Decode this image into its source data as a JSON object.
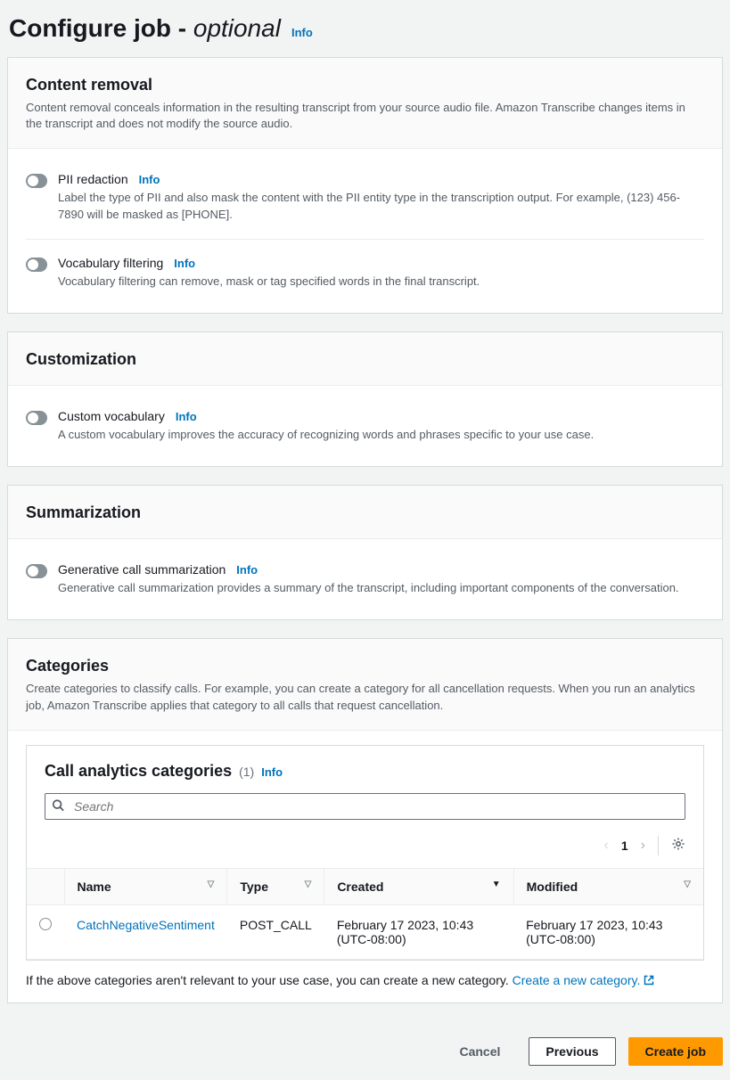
{
  "header": {
    "title_main": "Configure job",
    "title_sep": " - ",
    "title_optional": "optional",
    "info": "Info"
  },
  "panels": {
    "content_removal": {
      "title": "Content removal",
      "desc": "Content removal conceals information in the resulting transcript from your source audio file. Amazon Transcribe changes items in the transcript and does not modify the source audio.",
      "pii": {
        "label": "PII redaction",
        "info": "Info",
        "desc": "Label the type of PII and also mask the content with the PII entity type in the transcription output. For example, (123) 456-7890 will be masked as [PHONE]."
      },
      "vocab_filter": {
        "label": "Vocabulary filtering",
        "info": "Info",
        "desc": "Vocabulary filtering can remove, mask or tag specified words in the final transcript."
      }
    },
    "customization": {
      "title": "Customization",
      "custom_vocab": {
        "label": "Custom vocabulary",
        "info": "Info",
        "desc": "A custom vocabulary improves the accuracy of recognizing words and phrases specific to your use case."
      }
    },
    "summarization": {
      "title": "Summarization",
      "gen_sum": {
        "label": "Generative call summarization",
        "info": "Info",
        "desc": "Generative call summarization provides a summary of the transcript, including important components of the conversation."
      }
    },
    "categories": {
      "title": "Categories",
      "desc": "Create categories to classify calls. For example, you can create a category for all cancellation requests. When you run an analytics job, Amazon Transcribe applies that category to all calls that request cancellation.",
      "inner_title": "Call analytics categories",
      "count": "(1)",
      "info": "Info",
      "search_placeholder": "Search",
      "page": "1",
      "columns": {
        "name": "Name",
        "type": "Type",
        "created": "Created",
        "modified": "Modified"
      },
      "rows": [
        {
          "name": "CatchNegativeSentiment",
          "type": "POST_CALL",
          "created": "February 17 2023, 10:43 (UTC-08:00)",
          "modified": "February 17 2023, 10:43 (UTC-08:00)"
        }
      ],
      "below_text": "If the above categories aren't relevant to your use case, you can create a new category. ",
      "create_link": "Create a new category."
    }
  },
  "footer": {
    "cancel": "Cancel",
    "previous": "Previous",
    "create": "Create job"
  }
}
